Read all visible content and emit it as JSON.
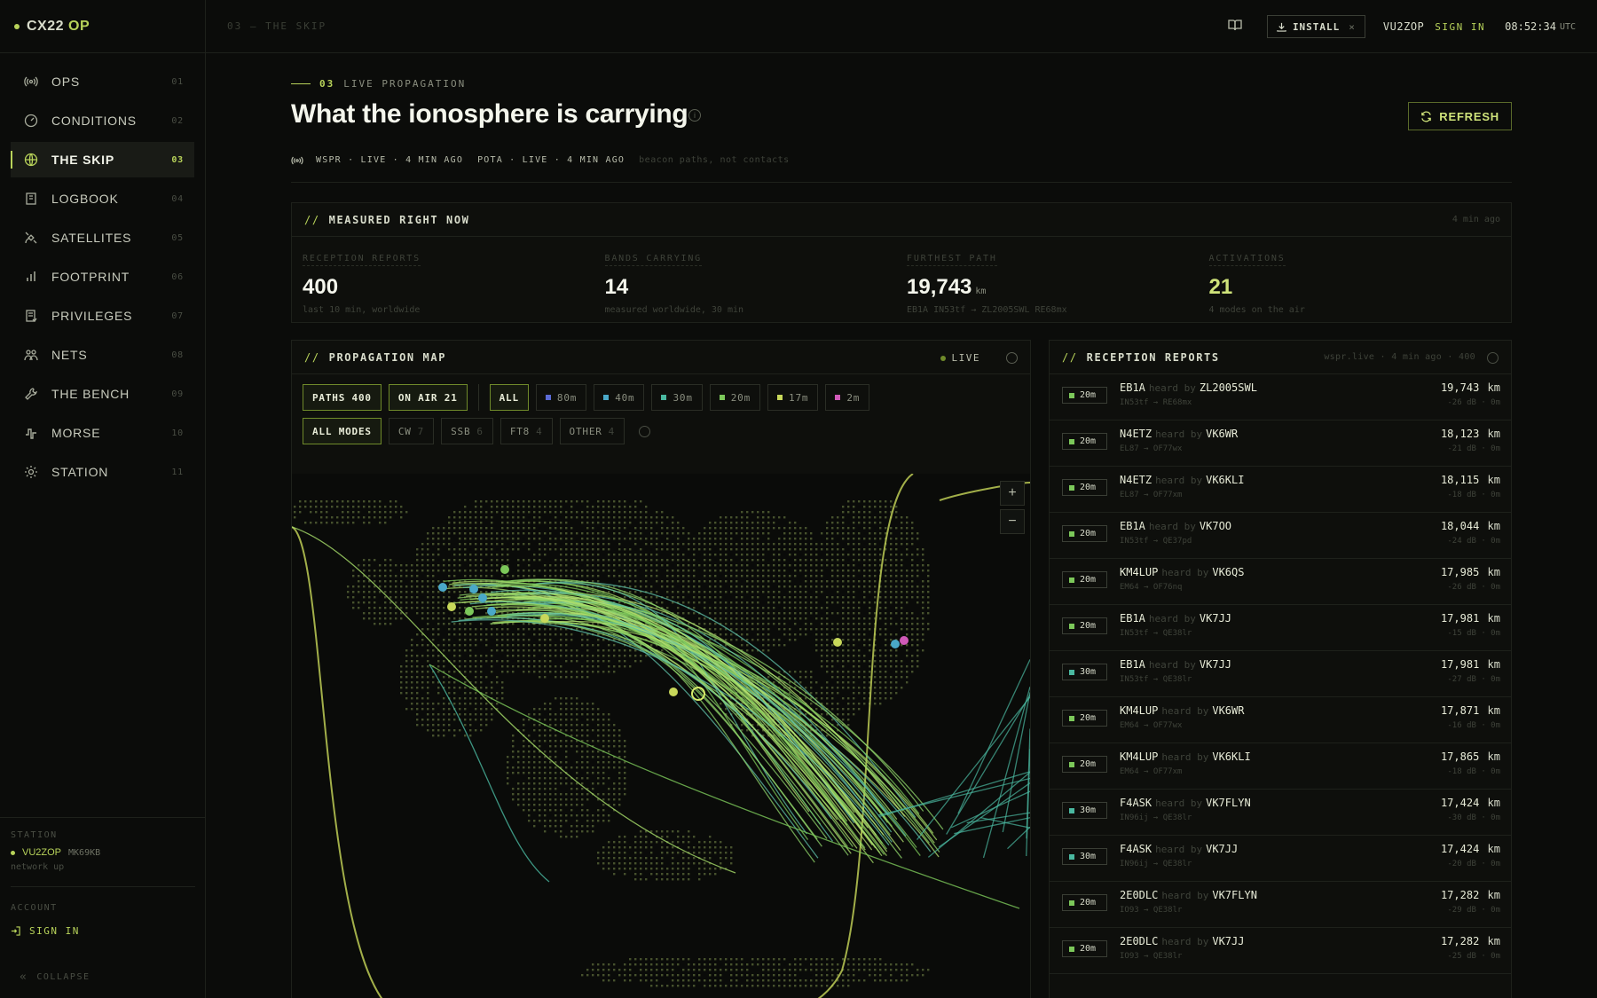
{
  "brand": {
    "name": "CX22",
    "suffix": "OP"
  },
  "nav": [
    {
      "label": "OPS",
      "num": "01",
      "icon": "radio-tower-icon"
    },
    {
      "label": "CONDITIONS",
      "num": "02",
      "icon": "gauge-icon"
    },
    {
      "label": "THE SKIP",
      "num": "03",
      "icon": "globe-icon",
      "active": true
    },
    {
      "label": "LOGBOOK",
      "num": "04",
      "icon": "book-icon"
    },
    {
      "label": "SATELLITES",
      "num": "05",
      "icon": "satellite-icon"
    },
    {
      "label": "FOOTPRINT",
      "num": "06",
      "icon": "bar-chart-icon"
    },
    {
      "label": "PRIVILEGES",
      "num": "07",
      "icon": "license-icon"
    },
    {
      "label": "NETS",
      "num": "08",
      "icon": "people-icon"
    },
    {
      "label": "THE BENCH",
      "num": "09",
      "icon": "wrench-icon"
    },
    {
      "label": "MORSE",
      "num": "10",
      "icon": "morse-icon"
    },
    {
      "label": "STATION",
      "num": "11",
      "icon": "gear-icon"
    }
  ],
  "sidebar_bottom": {
    "station_label": "STATION",
    "callsign": "VU2ZOP",
    "grid": "MK69KB",
    "status": "network up",
    "account_label": "ACCOUNT",
    "signin": "SIGN IN",
    "collapse": "COLLAPSE"
  },
  "topbar": {
    "crumb": "03 — THE SKIP",
    "install": "INSTALL",
    "callsign": "VU2ZOP",
    "signin": "SIGN IN",
    "time": "08:52:34",
    "tz": "UTC"
  },
  "page": {
    "eyebrow_num": "03",
    "eyebrow_text": "LIVE PROPAGATION",
    "title": "What the ionosphere is carrying",
    "refresh": "REFRESH",
    "source_wspr": "WSPR · LIVE · 4 MIN AGO",
    "source_pota": "POTA · LIVE · 4 MIN AGO",
    "source_note": "beacon paths, not contacts"
  },
  "measured": {
    "title": "MEASURED RIGHT NOW",
    "ago": "4 min ago",
    "stats": [
      {
        "label": "RECEPTION REPORTS",
        "value": "400",
        "unit": "",
        "sub": "last 10 min, worldwide"
      },
      {
        "label": "BANDS CARRYING",
        "value": "14",
        "unit": "",
        "sub": "measured worldwide, 30 min"
      },
      {
        "label": "FURTHEST PATH",
        "value": "19,743",
        "unit": "km",
        "sub": "EB1A IN53tf → ZL2005SWL RE68mx"
      },
      {
        "label": "ACTIVATIONS",
        "value": "21",
        "unit": "",
        "sub": "4 modes on the air"
      }
    ]
  },
  "map": {
    "title": "PROPAGATION MAP",
    "live": "LIVE",
    "chips_row1": [
      {
        "label": "PATHS 400",
        "on": true
      },
      {
        "label": "ON AIR 21",
        "on": true
      }
    ],
    "bands": [
      {
        "label": "ALL",
        "on": true,
        "color": ""
      },
      {
        "label": "80m",
        "on": false,
        "color": "#5b6bd6"
      },
      {
        "label": "40m",
        "on": false,
        "color": "#4aa8c8"
      },
      {
        "label": "30m",
        "on": false,
        "color": "#4ab8a0"
      },
      {
        "label": "20m",
        "on": false,
        "color": "#7cc85a"
      },
      {
        "label": "17m",
        "on": false,
        "color": "#c8d85a"
      },
      {
        "label": "2m",
        "on": false,
        "color": "#d05ab8"
      }
    ],
    "modes": [
      {
        "label": "ALL MODES",
        "count": "",
        "on": true
      },
      {
        "label": "CW",
        "count": "7",
        "on": false
      },
      {
        "label": "SSB",
        "count": "6",
        "on": false
      },
      {
        "label": "FT8",
        "count": "4",
        "on": false
      },
      {
        "label": "OTHER",
        "count": "4",
        "on": false
      }
    ],
    "zoom_in": "+",
    "zoom_out": "−"
  },
  "reports": {
    "title": "RECEPTION REPORTS",
    "meta": "wspr.live · 4 min ago · 400",
    "heard_by": "heard by",
    "rows": [
      {
        "band": "20m",
        "tx": "EB1A",
        "rx": "ZL2005SWL",
        "grid": "IN53tf → RE68mx",
        "dist": "19,743",
        "snr": "-26 dB · 0m"
      },
      {
        "band": "20m",
        "tx": "N4ETZ",
        "rx": "VK6WR",
        "grid": "EL87 → OF77wx",
        "dist": "18,123",
        "snr": "-21 dB · 0m"
      },
      {
        "band": "20m",
        "tx": "N4ETZ",
        "rx": "VK6KLI",
        "grid": "EL87 → OF77xm",
        "dist": "18,115",
        "snr": "-18 dB · 0m"
      },
      {
        "band": "20m",
        "tx": "EB1A",
        "rx": "VK7OO",
        "grid": "IN53tf → QE37pd",
        "dist": "18,044",
        "snr": "-24 dB · 0m"
      },
      {
        "band": "20m",
        "tx": "KM4LUP",
        "rx": "VK6QS",
        "grid": "EM64 → OF76nq",
        "dist": "17,985",
        "snr": "-26 dB · 0m"
      },
      {
        "band": "20m",
        "tx": "EB1A",
        "rx": "VK7JJ",
        "grid": "IN53tf → QE38lr",
        "dist": "17,981",
        "snr": "-15 dB · 0m"
      },
      {
        "band": "30m",
        "tx": "EB1A",
        "rx": "VK7JJ",
        "grid": "IN53tf → QE38lr",
        "dist": "17,981",
        "snr": "-27 dB · 0m"
      },
      {
        "band": "20m",
        "tx": "KM4LUP",
        "rx": "VK6WR",
        "grid": "EM64 → OF77wx",
        "dist": "17,871",
        "snr": "-16 dB · 0m"
      },
      {
        "band": "20m",
        "tx": "KM4LUP",
        "rx": "VK6KLI",
        "grid": "EM64 → OF77xm",
        "dist": "17,865",
        "snr": "-18 dB · 0m"
      },
      {
        "band": "30m",
        "tx": "F4ASK",
        "rx": "VK7FLYN",
        "grid": "IN96ij → QE38lr",
        "dist": "17,424",
        "snr": "-30 dB · 0m"
      },
      {
        "band": "30m",
        "tx": "F4ASK",
        "rx": "VK7JJ",
        "grid": "IN96ij → QE38lr",
        "dist": "17,424",
        "snr": "-20 dB · 0m"
      },
      {
        "band": "20m",
        "tx": "2E0DLC",
        "rx": "VK7FLYN",
        "grid": "IO93 → QE38lr",
        "dist": "17,282",
        "snr": "-29 dB · 0m"
      },
      {
        "band": "20m",
        "tx": "2E0DLC",
        "rx": "VK7JJ",
        "grid": "IO93 → QE38lr",
        "dist": "17,282",
        "snr": "-25 dB · 0m"
      }
    ]
  },
  "colors": {
    "accent": "#b8d35a",
    "band_20m": "#7cc85a",
    "band_30m": "#4ab8a0"
  }
}
